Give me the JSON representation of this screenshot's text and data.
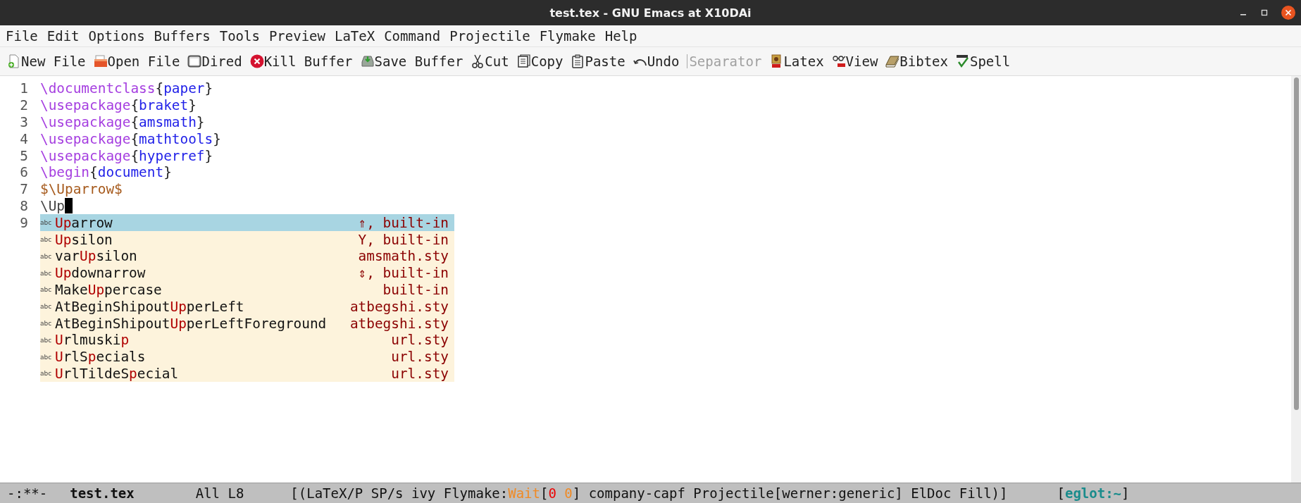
{
  "window": {
    "title": "test.tex - GNU Emacs at X10DAi"
  },
  "menu": [
    "File",
    "Edit",
    "Options",
    "Buffers",
    "Tools",
    "Preview",
    "LaTeX",
    "Command",
    "Projectile",
    "Flymake",
    "Help"
  ],
  "toolbar": [
    {
      "label": "New File",
      "disabled": false
    },
    {
      "label": "Open File",
      "disabled": false
    },
    {
      "label": "Dired",
      "disabled": false
    },
    {
      "label": "Kill Buffer",
      "disabled": false
    },
    {
      "label": "Save Buffer",
      "disabled": false
    },
    {
      "label": "Cut",
      "disabled": false
    },
    {
      "label": "Copy",
      "disabled": false
    },
    {
      "label": "Paste",
      "disabled": false
    },
    {
      "label": "Undo",
      "disabled": false
    },
    {
      "label": "Separator",
      "disabled": true
    },
    {
      "label": "Latex",
      "disabled": false
    },
    {
      "label": "View",
      "disabled": false
    },
    {
      "label": "Bibtex",
      "disabled": false
    },
    {
      "label": "Spell",
      "disabled": false
    }
  ],
  "editor": {
    "lines": [
      {
        "number": "1",
        "tokens": [
          {
            "text": "\\documentclass",
            "kind": "command"
          },
          {
            "text": "{",
            "kind": "brace"
          },
          {
            "text": "paper",
            "kind": "arg"
          },
          {
            "text": "}",
            "kind": "brace"
          }
        ]
      },
      {
        "number": "2",
        "tokens": [
          {
            "text": "\\usepackage",
            "kind": "command"
          },
          {
            "text": "{",
            "kind": "brace"
          },
          {
            "text": "braket",
            "kind": "arg"
          },
          {
            "text": "}",
            "kind": "brace"
          }
        ]
      },
      {
        "number": "3",
        "tokens": [
          {
            "text": "\\usepackage",
            "kind": "command"
          },
          {
            "text": "{",
            "kind": "brace"
          },
          {
            "text": "amsmath",
            "kind": "arg"
          },
          {
            "text": "}",
            "kind": "brace"
          }
        ]
      },
      {
        "number": "4",
        "tokens": [
          {
            "text": "\\usepackage",
            "kind": "command"
          },
          {
            "text": "{",
            "kind": "brace"
          },
          {
            "text": "mathtools",
            "kind": "arg"
          },
          {
            "text": "}",
            "kind": "brace"
          }
        ]
      },
      {
        "number": "5",
        "tokens": [
          {
            "text": "\\usepackage",
            "kind": "command"
          },
          {
            "text": "{",
            "kind": "brace"
          },
          {
            "text": "hyperref",
            "kind": "arg"
          },
          {
            "text": "}",
            "kind": "brace"
          }
        ]
      },
      {
        "number": "6",
        "tokens": [
          {
            "text": "\\begin",
            "kind": "command"
          },
          {
            "text": "{",
            "kind": "brace"
          },
          {
            "text": "document",
            "kind": "arg"
          },
          {
            "text": "}",
            "kind": "brace"
          }
        ]
      },
      {
        "number": "7",
        "tokens": [
          {
            "text": "$\\Uparrow$",
            "kind": "math"
          }
        ]
      },
      {
        "number": "8",
        "tokens": [
          {
            "text": "\\Up",
            "kind": "plain"
          }
        ],
        "cursor": true
      },
      {
        "number": "9"
      }
    ],
    "completions": [
      {
        "badge": "abc",
        "parts": [
          {
            "text": "Up",
            "match": true
          },
          {
            "text": "arrow",
            "match": false
          }
        ],
        "annotation": "⇑, built-in",
        "selected": true
      },
      {
        "badge": "abc",
        "parts": [
          {
            "text": "Up",
            "match": true
          },
          {
            "text": "silon",
            "match": false
          }
        ],
        "annotation": "Υ, built-in",
        "selected": false
      },
      {
        "badge": "abc",
        "parts": [
          {
            "text": "var",
            "match": false
          },
          {
            "text": "Up",
            "match": true
          },
          {
            "text": "silon",
            "match": false
          }
        ],
        "annotation": "amsmath.sty",
        "selected": false
      },
      {
        "badge": "abc",
        "parts": [
          {
            "text": "Up",
            "match": true
          },
          {
            "text": "downarrow",
            "match": false
          }
        ],
        "annotation": "⇕, built-in",
        "selected": false
      },
      {
        "badge": "abc",
        "parts": [
          {
            "text": "Make",
            "match": false
          },
          {
            "text": "Up",
            "match": true
          },
          {
            "text": "percase",
            "match": false
          }
        ],
        "annotation": "built-in",
        "selected": false
      },
      {
        "badge": "abc",
        "parts": [
          {
            "text": "AtBeginShipout",
            "match": false
          },
          {
            "text": "Up",
            "match": true
          },
          {
            "text": "perLeft",
            "match": false
          }
        ],
        "annotation": "atbegshi.sty",
        "selected": false
      },
      {
        "badge": "abc",
        "parts": [
          {
            "text": "AtBeginShipout",
            "match": false
          },
          {
            "text": "Up",
            "match": true
          },
          {
            "text": "perLeftForeground",
            "match": false
          }
        ],
        "annotation": "atbegshi.sty",
        "selected": false
      },
      {
        "badge": "abc",
        "parts": [
          {
            "text": "U",
            "match": true
          },
          {
            "text": "rlmuski",
            "match": false
          },
          {
            "text": "p",
            "match": true
          }
        ],
        "annotation": "url.sty",
        "selected": false
      },
      {
        "badge": "abc",
        "parts": [
          {
            "text": "U",
            "match": true
          },
          {
            "text": "rlS",
            "match": false
          },
          {
            "text": "p",
            "match": true
          },
          {
            "text": "ecials",
            "match": false
          }
        ],
        "annotation": "url.sty",
        "selected": false
      },
      {
        "badge": "abc",
        "parts": [
          {
            "text": "U",
            "match": true
          },
          {
            "text": "rlTildeS",
            "match": false
          },
          {
            "text": "p",
            "match": true
          },
          {
            "text": "ecial",
            "match": false
          }
        ],
        "annotation": "url.sty",
        "selected": false
      }
    ]
  },
  "status_bar": {
    "state": "-:**-",
    "buffer": "test.tex",
    "position": "All L8",
    "modes": [
      {
        "text": "[(LaTeX/P SP/s ivy Flymake:",
        "kind": "plain"
      },
      {
        "text": "Wait",
        "kind": "warn"
      },
      {
        "text": "[",
        "kind": "plain"
      },
      {
        "text": "0 ",
        "kind": "error"
      },
      {
        "text": "0",
        "kind": "warn"
      },
      {
        "text": "] company-capf Projectile[werner:generic] ElDoc Fill)]",
        "kind": "plain"
      }
    ],
    "extra": [
      {
        "text": "[",
        "kind": "plain"
      },
      {
        "text": "eglot:~",
        "kind": "accent"
      },
      {
        "text": "]",
        "kind": "plain"
      }
    ]
  }
}
